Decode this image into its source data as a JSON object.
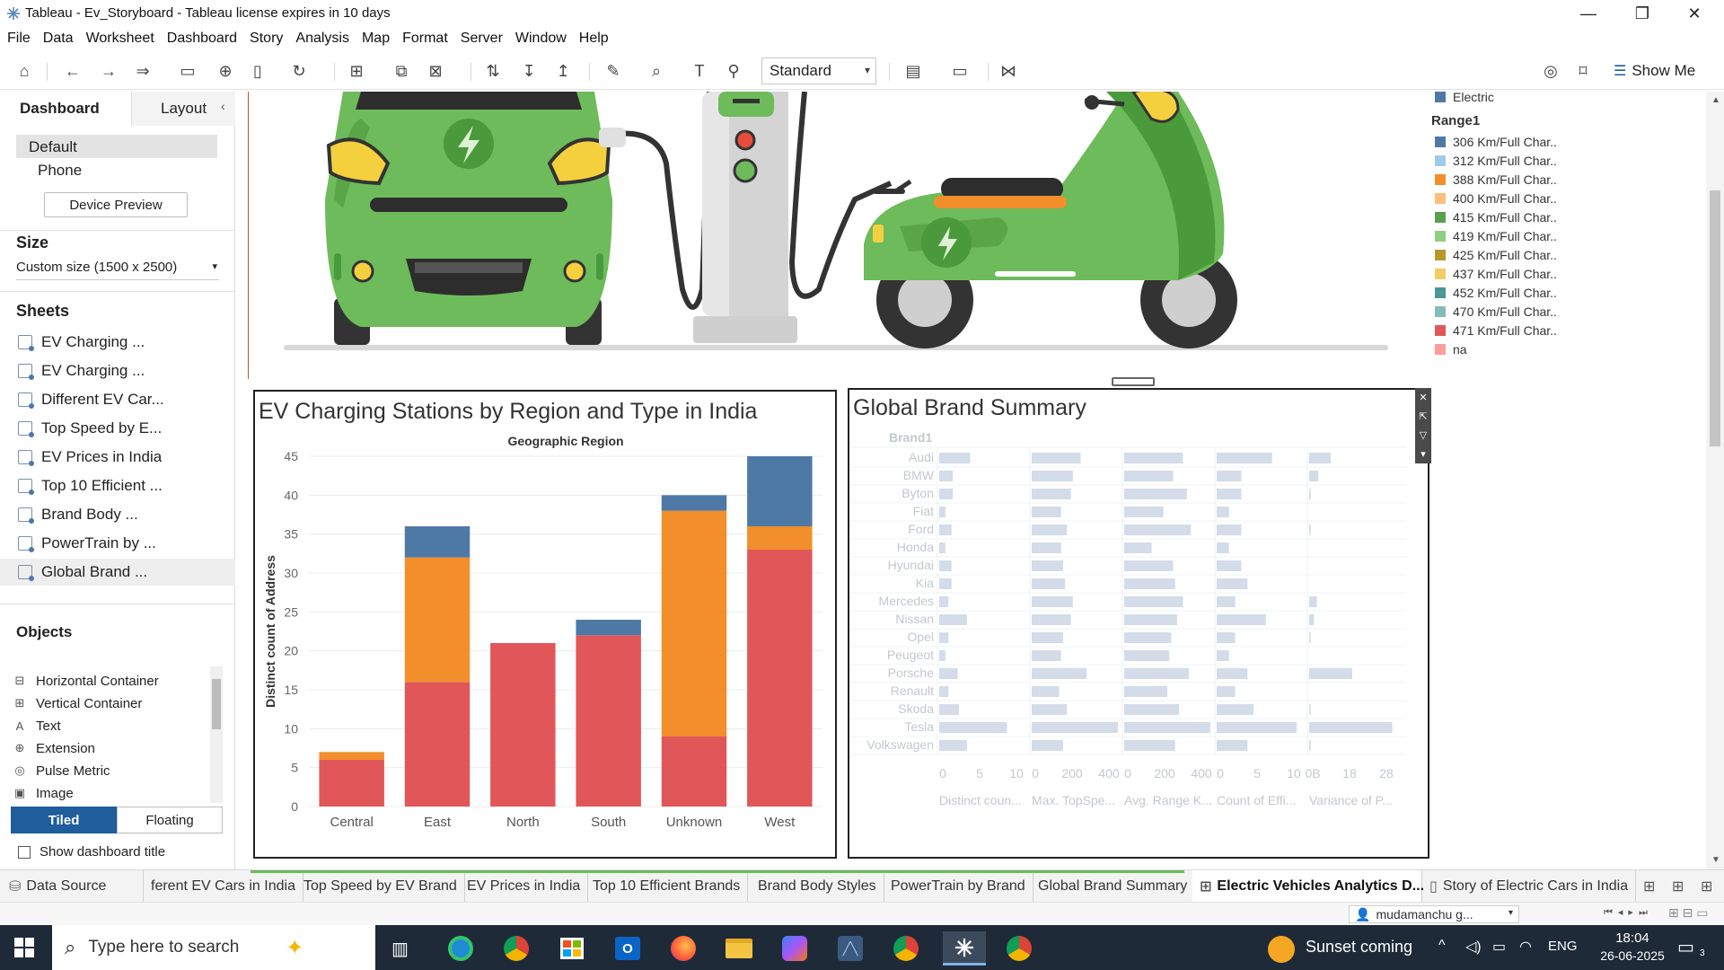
{
  "window": {
    "title": "Tableau - Ev_Storyboard - Tableau license expires in 10 days",
    "minimize": "—",
    "restore": "❐",
    "close": "✕"
  },
  "menu": [
    "File",
    "Data",
    "Worksheet",
    "Dashboard",
    "Story",
    "Analysis",
    "Map",
    "Format",
    "Server",
    "Window",
    "Help"
  ],
  "toolbar": {
    "fit_value": "Standard",
    "show_me": "Show Me"
  },
  "left_pane": {
    "tabs": [
      "Dashboard",
      "Layout"
    ],
    "devices": [
      "Default",
      "Phone"
    ],
    "device_preview": "Device Preview",
    "size_label": "Size",
    "size_value": "Custom size (1500 x 2500)",
    "sheets_label": "Sheets",
    "sheets": [
      "EV Charging ...",
      "EV Charging ...",
      "Different EV Car...",
      "Top Speed by E...",
      "EV Prices in India",
      "Top 10 Efficient ...",
      "Brand Body ...",
      "PowerTrain by ...",
      "Global Brand ..."
    ],
    "objects_label": "Objects",
    "objects": [
      "Horizontal Container",
      "Vertical Container",
      "Text",
      "Extension",
      "Pulse Metric",
      "Image"
    ],
    "object_icons": [
      "⊟",
      "⊞",
      "A",
      "⊕",
      "◎",
      "▣"
    ],
    "layout_modes": [
      "Tiled",
      "Floating"
    ],
    "show_title": "Show dashboard title"
  },
  "charts": {
    "region_title": "EV Charging Stations by Region and Type in India",
    "global_title": "Global Brand Summary"
  },
  "chart_data": [
    {
      "type": "bar",
      "stacked": true,
      "title": "EV Charging Stations by Region and Type in India",
      "top_label": "Geographic Region",
      "ylabel": "Distinct count of Address",
      "xlabel": "",
      "categories": [
        "Central",
        "East",
        "North",
        "South",
        "Unknown",
        "West"
      ],
      "yticks": [
        0,
        5,
        10,
        15,
        20,
        25,
        30,
        35,
        40,
        45
      ],
      "ylim": [
        0,
        45
      ],
      "grid": true,
      "series": [
        {
          "color": "#e15759",
          "values": [
            6,
            16,
            21,
            22,
            9,
            33
          ]
        },
        {
          "color": "#f28e2b",
          "values": [
            1,
            16,
            0,
            0,
            29,
            3
          ]
        },
        {
          "color": "#4e79a7",
          "values": [
            0,
            4,
            0,
            2,
            2,
            9
          ]
        }
      ]
    },
    {
      "type": "bar",
      "title": "Global Brand Summary",
      "row_header": "Brand1",
      "categories": [
        "Audi",
        "BMW",
        "Byton",
        "Fiat",
        "Ford",
        "Honda",
        "Hyundai",
        "Kia",
        "Mercedes",
        "Nissan",
        "Opel",
        "Peugeot",
        "Porsche",
        "Renault",
        "Skoda",
        "Tesla",
        "Volkswagen"
      ],
      "series": [
        {
          "name": "Distinct coun...",
          "ticks": [
            "0",
            "5",
            "10"
          ],
          "xlim": [
            0,
            14
          ],
          "values": [
            5,
            2.2,
            2.2,
            1,
            2,
            1,
            2,
            2,
            1.5,
            4.5,
            1.5,
            1,
            3,
            1.5,
            3.2,
            11,
            4.5
          ]
        },
        {
          "name": "Max. TopSpe...",
          "ticks": [
            "0",
            "200",
            "400"
          ],
          "xlim": [
            0,
            440
          ],
          "values": [
            250,
            210,
            200,
            150,
            180,
            150,
            160,
            170,
            210,
            200,
            160,
            150,
            280,
            140,
            180,
            440,
            160
          ]
        },
        {
          "name": "Avg. Range K...",
          "ticks": [
            "0",
            "200",
            "400"
          ],
          "xlim": [
            0,
            440
          ],
          "values": [
            300,
            250,
            320,
            200,
            340,
            140,
            250,
            260,
            300,
            270,
            240,
            230,
            330,
            220,
            280,
            440,
            260
          ]
        },
        {
          "name": "Count of Effi...",
          "ticks": [
            "0",
            "5",
            "10"
          ],
          "xlim": [
            0,
            14
          ],
          "values": [
            9,
            4,
            4,
            2,
            4,
            2,
            4,
            5,
            3,
            8,
            3,
            2,
            5,
            3,
            6,
            13,
            5
          ]
        },
        {
          "name": "Variance of P...",
          "ticks": [
            "0B",
            "18",
            "28"
          ],
          "xlim": [
            0,
            28
          ],
          "values": [
            7,
            3,
            0.5,
            0,
            0.5,
            0,
            0,
            0,
            2.5,
            1.5,
            0.5,
            0,
            14,
            0,
            0.5,
            27,
            0.5
          ]
        }
      ]
    }
  ],
  "legend": {
    "partial_top": "Electric",
    "partial_top_color": "#4e79a7",
    "title": "Range1",
    "items": [
      {
        "label": "306 Km/Full Char..",
        "color": "#4e79a7"
      },
      {
        "label": "312 Km/Full Char..",
        "color": "#a0cbe8"
      },
      {
        "label": "388 Km/Full Char..",
        "color": "#f28e2b"
      },
      {
        "label": "400 Km/Full Char..",
        "color": "#ffbe7d"
      },
      {
        "label": "415 Km/Full Char..",
        "color": "#59a14f"
      },
      {
        "label": "419 Km/Full Char..",
        "color": "#8cd17d"
      },
      {
        "label": "425 Km/Full Char..",
        "color": "#b6992d"
      },
      {
        "label": "437 Km/Full Char..",
        "color": "#f1ce63"
      },
      {
        "label": "452 Km/Full Char..",
        "color": "#499894"
      },
      {
        "label": "470 Km/Full Char..",
        "color": "#86bcb6"
      },
      {
        "label": "471 Km/Full Char..",
        "color": "#e15759"
      },
      {
        "label": "na",
        "color": "#ff9d9a"
      }
    ]
  },
  "sheet_tabs": {
    "data_source": "Data Source",
    "tabs": [
      "ferent EV Cars in India",
      "Top Speed by EV Brand",
      "EV Prices in India",
      "Top 10 Efficient Brands",
      "Brand Body Styles",
      "PowerTrain by Brand",
      "Global Brand Summary",
      "Electric Vehicles Analytics D...",
      "Story of Electric Cars in India"
    ],
    "active_index": 7
  },
  "status": {
    "user": "mudamanchu g..."
  },
  "taskbar": {
    "search_placeholder": "Type here to search",
    "weather": "Sunset coming",
    "lang": "ENG",
    "time": "18:04",
    "date": "26-06-2025",
    "notifications": "3"
  },
  "colors": {
    "accent": "#1f5d9c",
    "car_green": "#6dbb5a",
    "bar_red": "#e15759",
    "bar_orange": "#f28e2b",
    "bar_blue": "#4e79a7",
    "faded_bar": "#d3dce8"
  }
}
